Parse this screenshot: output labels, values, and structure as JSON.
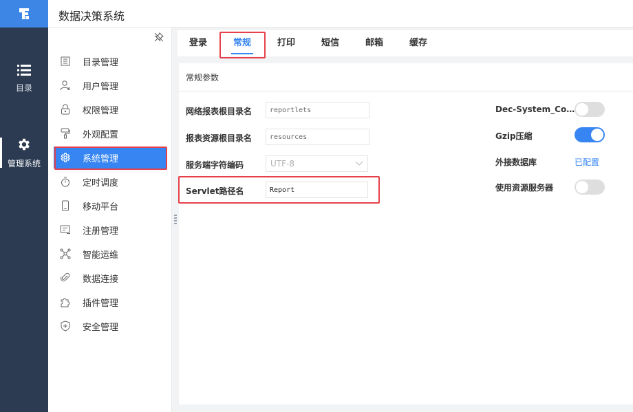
{
  "app": {
    "title": "数据决策系统",
    "accent_color": "#3685f2",
    "rail_color": "#2c3b52",
    "highlight_color": "#e5414b"
  },
  "rail": {
    "items": [
      {
        "label": "目录",
        "icon": "list-icon"
      },
      {
        "label": "管理系统",
        "icon": "gear-icon"
      }
    ]
  },
  "sidebar": {
    "items": [
      {
        "label": "目录管理",
        "icon": "directory-icon"
      },
      {
        "label": "用户管理",
        "icon": "user-icon"
      },
      {
        "label": "权限管理",
        "icon": "lock-icon"
      },
      {
        "label": "外观配置",
        "icon": "paint-roller-icon"
      },
      {
        "label": "系统管理",
        "icon": "gear-icon"
      },
      {
        "label": "定时调度",
        "icon": "timer-icon"
      },
      {
        "label": "移动平台",
        "icon": "mobile-icon"
      },
      {
        "label": "注册管理",
        "icon": "register-icon"
      },
      {
        "label": "智能运维",
        "icon": "network-icon"
      },
      {
        "label": "数据连接",
        "icon": "paperclip-icon"
      },
      {
        "label": "插件管理",
        "icon": "puzzle-icon"
      },
      {
        "label": "安全管理",
        "icon": "shield-icon"
      }
    ]
  },
  "tabs": [
    {
      "label": "登录"
    },
    {
      "label": "常规"
    },
    {
      "label": "打印"
    },
    {
      "label": "短信"
    },
    {
      "label": "邮箱"
    },
    {
      "label": "缓存"
    }
  ],
  "panel": {
    "title": "常规参数",
    "fields": [
      {
        "label": "网络报表根目录名",
        "value": "reportlets"
      },
      {
        "label": "报表资源根目录名",
        "value": "resources"
      },
      {
        "label": "服务端字符编码",
        "value": "UTF-8"
      },
      {
        "label": "Servlet路径名",
        "value": "Report"
      }
    ],
    "right": [
      {
        "label": "Dec-System_Conn...",
        "state": "off"
      },
      {
        "label": "Gzip压缩",
        "state": "on"
      },
      {
        "label": "外接数据库",
        "link": "已配置"
      },
      {
        "label": "使用资源服务器",
        "state": "off"
      }
    ]
  }
}
